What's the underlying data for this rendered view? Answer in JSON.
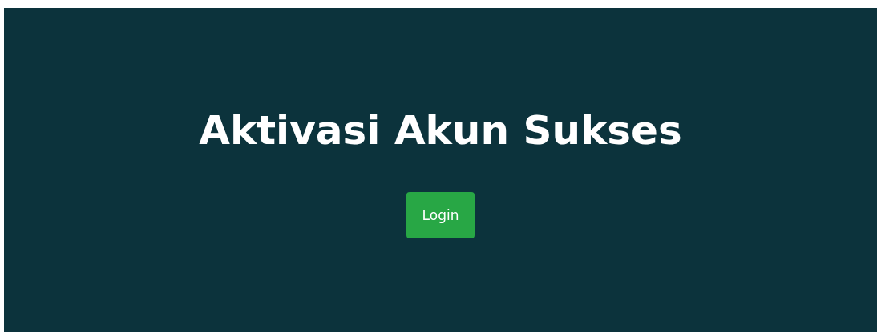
{
  "heading": "Aktivasi Akun Sukses",
  "button": {
    "label": "Login"
  }
}
